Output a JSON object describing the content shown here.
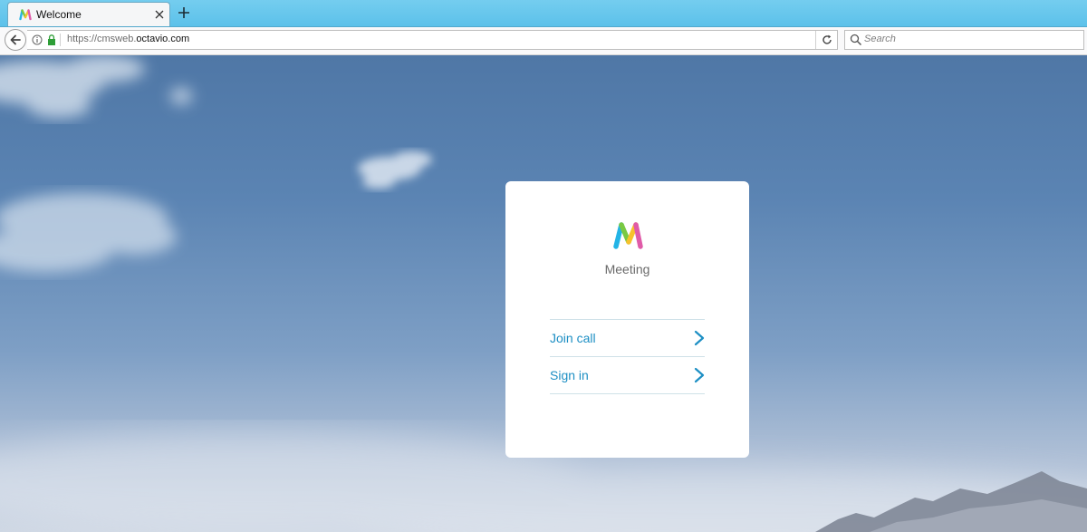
{
  "browser": {
    "tab": {
      "title": "Welcome",
      "favicon": "meeting-logo-icon"
    },
    "address": {
      "prefix": "https://cmsweb.",
      "domain": "octavio.com"
    },
    "search": {
      "placeholder": "Search"
    }
  },
  "card": {
    "brand": "Meeting",
    "items": [
      {
        "label": "Join call",
        "icon": "chevron-right-icon"
      },
      {
        "label": "Sign in",
        "icon": "chevron-right-icon"
      }
    ]
  },
  "colors": {
    "accent": "#1d8fc4",
    "tabstrip": "#5cc1ea",
    "logo": [
      "#23b4e6",
      "#7ac943",
      "#f7c22c",
      "#e05ba8",
      "#9b59d6"
    ]
  }
}
